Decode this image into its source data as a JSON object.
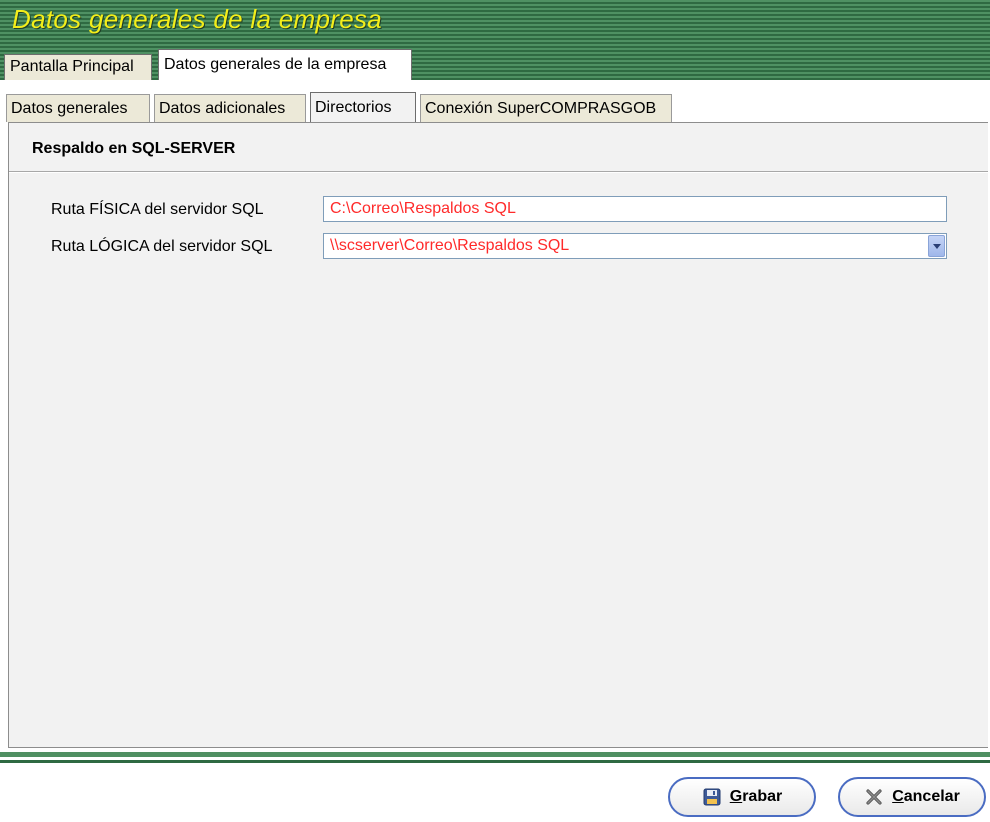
{
  "window": {
    "title": "Datos generales de la empresa"
  },
  "outer_tabs": [
    {
      "label": "Pantalla Principal",
      "active": false
    },
    {
      "label": "Datos generales de la empresa",
      "active": true
    }
  ],
  "inner_tabs": [
    {
      "label": "Datos generales",
      "active": false
    },
    {
      "label": "Datos adicionales",
      "active": false
    },
    {
      "label": "Directorios",
      "active": true
    },
    {
      "label": "Conexión SuperCOMPRASGOB",
      "active": false
    }
  ],
  "section": {
    "title": "Respaldo en SQL-SERVER"
  },
  "fields": {
    "physical_path": {
      "label": "Ruta FÍSICA del servidor SQL",
      "value": "C:\\Correo\\Respaldos SQL"
    },
    "logical_path": {
      "label": "Ruta LÓGICA del servidor SQL",
      "value": "\\\\scserver\\Correo\\Respaldos SQL"
    }
  },
  "buttons": {
    "save": {
      "accel": "G",
      "rest": "rabar",
      "icon": "floppy-disk-icon"
    },
    "cancel": {
      "accel": "C",
      "rest": "ancelar",
      "icon": "x-close-icon"
    }
  },
  "colors": {
    "title_text": "#f3ee1a",
    "field_value_text": "#ff2a2a",
    "theme_green": "#3b7a4e"
  }
}
